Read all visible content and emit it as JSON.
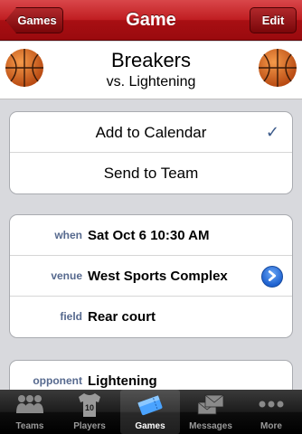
{
  "navbar": {
    "title": "Game",
    "back_label": "Games",
    "edit_label": "Edit"
  },
  "header": {
    "team_name": "Breakers",
    "opponent_line": "vs. Lightening"
  },
  "actions": [
    {
      "label": "Add to Calendar",
      "checked": true
    },
    {
      "label": "Send to Team",
      "checked": false
    }
  ],
  "checkmark": "✓",
  "details": [
    {
      "label": "when",
      "value": "Sat Oct 6 10:30 AM"
    },
    {
      "label": "venue",
      "value": "West Sports Complex"
    },
    {
      "label": "field",
      "value": "Rear court"
    }
  ],
  "opponent": {
    "label": "opponent",
    "value": "Lightening"
  },
  "tabs": [
    {
      "label": "Teams",
      "icon": "teams-icon",
      "selected": false
    },
    {
      "label": "Players",
      "icon": "jersey-icon",
      "selected": false,
      "jersey_number": "10"
    },
    {
      "label": "Games",
      "icon": "ticket-icon",
      "selected": true
    },
    {
      "label": "Messages",
      "icon": "messages-icon",
      "selected": false
    },
    {
      "label": "More",
      "icon": "more-icon",
      "selected": false
    }
  ],
  "colors": {
    "navbar": "#c01d21",
    "label_blue": "#56698e",
    "checkmark": "#3b5a8a",
    "disclosure": "#1f62d0",
    "ball": "#e0702a"
  }
}
